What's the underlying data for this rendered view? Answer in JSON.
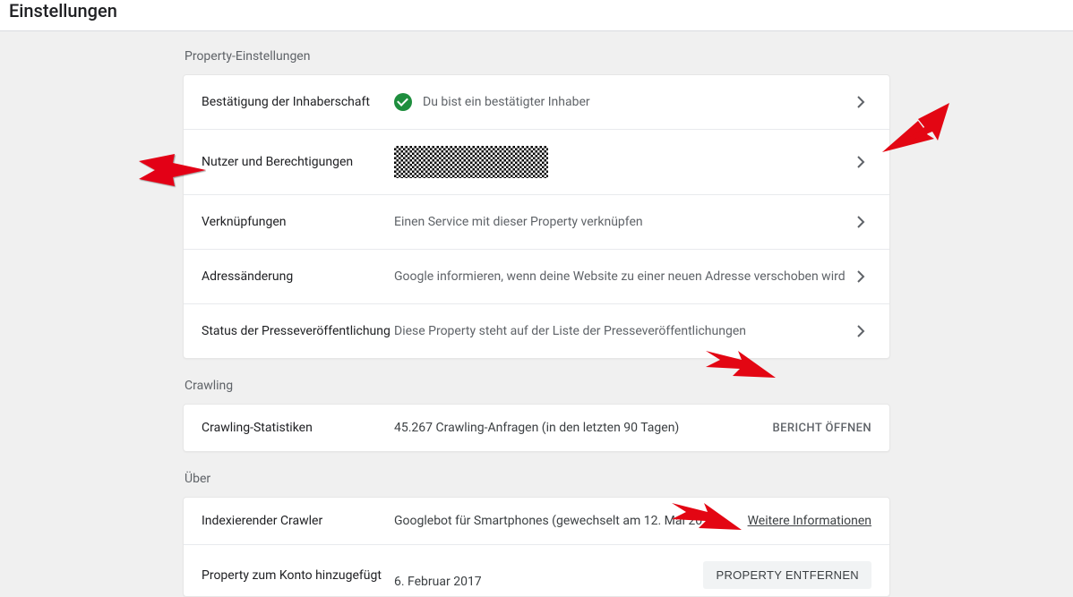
{
  "header": {
    "title": "Einstellungen"
  },
  "property_settings": {
    "title": "Property-Einstellungen",
    "rows": {
      "ownership": {
        "label": "Bestätigung der Inhaberschaft",
        "status": "Du bist ein bestätigter Inhaber"
      },
      "users": {
        "label": "Nutzer und Berechtigungen"
      },
      "associations": {
        "label": "Verknüpfungen",
        "desc": "Einen Service mit dieser Property verknüpfen"
      },
      "address": {
        "label": "Adressänderung",
        "desc": "Google informieren, wenn deine Website zu einer neuen Adresse verschoben wird"
      },
      "press": {
        "label": "Status der Presseveröffentlichung",
        "desc": "Diese Property steht auf der Liste der Presseveröffentlichungen"
      }
    }
  },
  "crawling": {
    "title": "Crawling",
    "stats": {
      "label": "Crawling-Statistiken",
      "desc": "45.267 Crawling-Anfragen (in den letzten 90 Tagen)",
      "action": "BERICHT ÖFFNEN"
    }
  },
  "about": {
    "title": "Über",
    "crawler": {
      "label": "Indexierender Crawler",
      "desc": "Googlebot für Smartphones (gewechselt am 12. Mai 2018)",
      "more": "Weitere Informationen"
    },
    "added": {
      "label": "Property zum Konto hinzugefügt",
      "date": "6. Februar 2017",
      "remove": "PROPERTY ENTFERNEN"
    }
  }
}
